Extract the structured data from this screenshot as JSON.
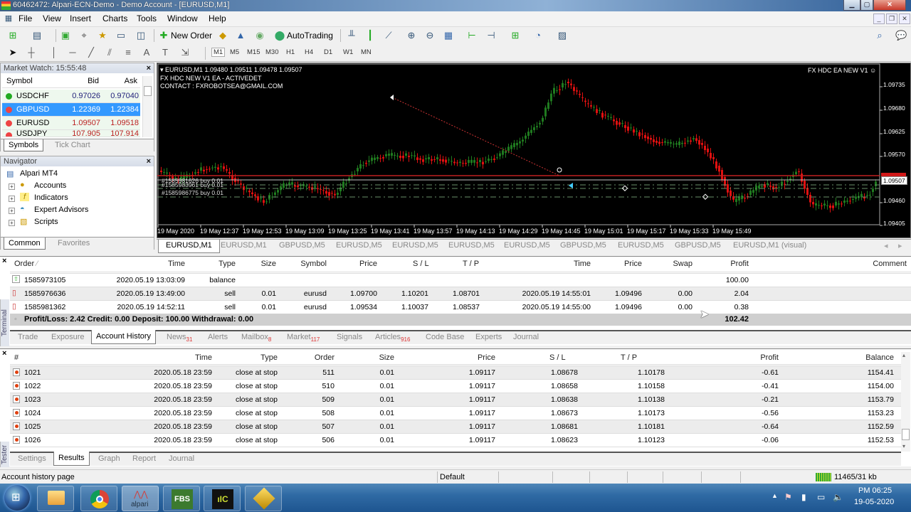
{
  "window": {
    "title": "60462472: Alpari-ECN-Demo - Demo Account - [EURUSD,M1]",
    "controls": [
      "minimize",
      "maximize",
      "close"
    ]
  },
  "menu": [
    "File",
    "View",
    "Insert",
    "Charts",
    "Tools",
    "Window",
    "Help"
  ],
  "toolbar": {
    "new_order": "New Order",
    "autotrading": "AutoTrading",
    "timeframes": [
      "M1",
      "M5",
      "M15",
      "M30",
      "H1",
      "H4",
      "D1",
      "W1",
      "MN"
    ],
    "active_timeframe": "M1"
  },
  "market_watch": {
    "title": "Market Watch: 15:55:48",
    "columns": [
      "Symbol",
      "Bid",
      "Ask"
    ],
    "rows": [
      {
        "symbol": "USDCHF",
        "bid": "0.97026",
        "ask": "0.97040",
        "direction": "up"
      },
      {
        "symbol": "GBPUSD",
        "bid": "1.22369",
        "ask": "1.22384",
        "direction": "down",
        "selected": true
      },
      {
        "symbol": "EURUSD",
        "bid": "1.09507",
        "ask": "1.09518",
        "direction": "down"
      },
      {
        "symbol": "USDJPY",
        "bid": "107.905",
        "ask": "107.914",
        "direction": "down"
      }
    ],
    "tabs": [
      "Symbols",
      "Tick Chart"
    ]
  },
  "navigator": {
    "title": "Navigator",
    "root": "Alpari MT4",
    "items": [
      "Accounts",
      "Indicators",
      "Expert Advisors",
      "Scripts"
    ],
    "tabs": [
      "Common",
      "Favorites"
    ]
  },
  "chart": {
    "header": "EURUSD,M1  1.09480 1.09511 1.09478 1.09507",
    "ea_line": "FX HDC NEW V1 EA -  ACTIVEDET",
    "contact_line": "CONTACT : FXROBOTSEA@GMAIL.COM",
    "ea_name": "FX HDC EA NEW V1",
    "current_price": "1.09507",
    "ask_price": "1.09518",
    "price_labels": [
      "1.09735",
      "1.09680",
      "1.09625",
      "1.09570",
      "1.09460",
      "1.09405"
    ],
    "time_labels": [
      "19 May 2020",
      "19 May 12:37",
      "19 May 12:53",
      "19 May 13:09",
      "19 May 13:25",
      "19 May 13:41",
      "19 May 13:57",
      "19 May 14:13",
      "19 May 14:29",
      "19 May 14:45",
      "19 May 15:01",
      "19 May 15:17",
      "19 May 15:33",
      "19 May 15:49"
    ],
    "order_labels": [
      "#1585981626 buy 0.01",
      "#1585983961 buy 0.01",
      "#1585986775 buy 0.01"
    ],
    "colors": {
      "bull": "#1f7a1f",
      "bear": "#e01010",
      "ask_line": "#c02020",
      "bid_line": "#c0c0c0",
      "order_line": "#6a8f6a"
    }
  },
  "chart_tabs": [
    "EURUSD,M1",
    "EURUSD,M1",
    "GBPUSD,M5",
    "EURUSD,M5",
    "EURUSD,M5",
    "EURUSD,M5",
    "EURUSD,M5",
    "GBPUSD,M5",
    "EURUSD,M5",
    "GBPUSD,M5",
    "EURUSD,M1 (visual)"
  ],
  "terminal": {
    "side_label": "Terminal",
    "columns": [
      "Order",
      "Time",
      "Type",
      "Size",
      "Symbol",
      "Price",
      "S / L",
      "T / P",
      "Time",
      "Price",
      "Swap",
      "Profit",
      "Comment"
    ],
    "rows": [
      {
        "order": "1585973105",
        "time": "2020.05.19 13:03:09",
        "type": "balance",
        "size": "",
        "symbol": "",
        "price": "",
        "sl": "",
        "tp": "",
        "close_time": "",
        "close_price": "",
        "swap": "",
        "profit": "100.00",
        "comment": ""
      },
      {
        "order": "1585976636",
        "time": "2020.05.19 13:49:00",
        "type": "sell",
        "size": "0.01",
        "symbol": "eurusd",
        "price": "1.09700",
        "sl": "1.10201",
        "tp": "1.08701",
        "close_time": "2020.05.19 14:55:01",
        "close_price": "1.09496",
        "swap": "0.00",
        "profit": "2.04",
        "comment": ""
      },
      {
        "order": "1585981362",
        "time": "2020.05.19 14:52:11",
        "type": "sell",
        "size": "0.01",
        "symbol": "eurusd",
        "price": "1.09534",
        "sl": "1.10037",
        "tp": "1.08537",
        "close_time": "2020.05.19 14:55:00",
        "close_price": "1.09496",
        "swap": "0.00",
        "profit": "0.38",
        "comment": ""
      }
    ],
    "summary": "Profit/Loss: 2.42  Credit: 0.00  Deposit: 100.00  Withdrawal: 0.00",
    "summary_total": "102.42",
    "tabs": [
      {
        "label": "Trade",
        "badge": ""
      },
      {
        "label": "Exposure",
        "badge": ""
      },
      {
        "label": "Account History",
        "badge": "",
        "active": true
      },
      {
        "label": "News",
        "badge": "31"
      },
      {
        "label": "Alerts",
        "badge": ""
      },
      {
        "label": "Mailbox",
        "badge": "8"
      },
      {
        "label": "Market",
        "badge": "117"
      },
      {
        "label": "Signals",
        "badge": ""
      },
      {
        "label": "Articles",
        "badge": "916"
      },
      {
        "label": "Code Base",
        "badge": ""
      },
      {
        "label": "Experts",
        "badge": ""
      },
      {
        "label": "Journal",
        "badge": ""
      }
    ]
  },
  "tester": {
    "side_label": "Tester",
    "columns": [
      "#",
      "Time",
      "Type",
      "Order",
      "Size",
      "Price",
      "S / L",
      "T / P",
      "Profit",
      "Balance"
    ],
    "rows": [
      {
        "n": "1021",
        "time": "2020.05.18 23:59",
        "type": "close at stop",
        "order": "511",
        "size": "0.01",
        "price": "1.09117",
        "sl": "1.08678",
        "tp": "1.10178",
        "profit": "-0.61",
        "balance": "1154.41"
      },
      {
        "n": "1022",
        "time": "2020.05.18 23:59",
        "type": "close at stop",
        "order": "510",
        "size": "0.01",
        "price": "1.09117",
        "sl": "1.08658",
        "tp": "1.10158",
        "profit": "-0.41",
        "balance": "1154.00"
      },
      {
        "n": "1023",
        "time": "2020.05.18 23:59",
        "type": "close at stop",
        "order": "509",
        "size": "0.01",
        "price": "1.09117",
        "sl": "1.08638",
        "tp": "1.10138",
        "profit": "-0.21",
        "balance": "1153.79"
      },
      {
        "n": "1024",
        "time": "2020.05.18 23:59",
        "type": "close at stop",
        "order": "508",
        "size": "0.01",
        "price": "1.09117",
        "sl": "1.08673",
        "tp": "1.10173",
        "profit": "-0.56",
        "balance": "1153.23"
      },
      {
        "n": "1025",
        "time": "2020.05.18 23:59",
        "type": "close at stop",
        "order": "507",
        "size": "0.01",
        "price": "1.09117",
        "sl": "1.08681",
        "tp": "1.10181",
        "profit": "-0.64",
        "balance": "1152.59"
      },
      {
        "n": "1026",
        "time": "2020.05.18 23:59",
        "type": "close at stop",
        "order": "506",
        "size": "0.01",
        "price": "1.09117",
        "sl": "1.08623",
        "tp": "1.10123",
        "profit": "-0.06",
        "balance": "1152.53"
      }
    ],
    "tabs": [
      "Settings",
      "Results",
      "Graph",
      "Report",
      "Journal"
    ],
    "active_tab": "Results"
  },
  "status_bar": {
    "left": "Account history page",
    "profile": "Default",
    "connection": "11465/31 kb"
  },
  "taskbar": {
    "apps": [
      "windows-start",
      "file-explorer",
      "chrome",
      "alpari",
      "fbs",
      "ic-markets",
      "mt4-terminal"
    ],
    "alpari_label": "alpari",
    "fbs_label": "FBS",
    "time": "PM 06:25",
    "date": "19-05-2020"
  }
}
